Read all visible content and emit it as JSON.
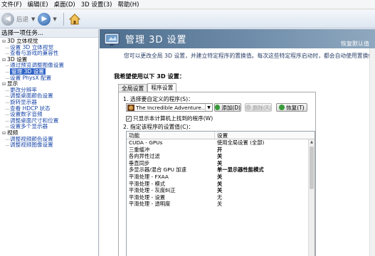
{
  "menu": [
    "文件(F)",
    "编辑(E)",
    "桌面(D)",
    "3D 设置(3)",
    "帮助(H)"
  ],
  "toolbar": {
    "back_label": "后退"
  },
  "left_panel": {
    "header": "选择一项任务...",
    "tree": [
      {
        "type": "cat",
        "label": "3D 立体视觉"
      },
      {
        "type": "child",
        "label": "设置 3D 立体视觉"
      },
      {
        "type": "child",
        "label": "查看与游戏的兼容性"
      },
      {
        "type": "cat",
        "label": "3D 设置"
      },
      {
        "type": "child",
        "label": "通过预览调整图像设置"
      },
      {
        "type": "child",
        "label": "管理 3D 设置",
        "selected": true
      },
      {
        "type": "child",
        "label": "设置 PhysX 配置"
      },
      {
        "type": "cat",
        "label": "显示"
      },
      {
        "type": "child",
        "label": "更改分辨率"
      },
      {
        "type": "child",
        "label": "调整桌面颜色设置"
      },
      {
        "type": "child",
        "label": "旋转显示器"
      },
      {
        "type": "child",
        "label": "查看 HDCP 状态"
      },
      {
        "type": "child",
        "label": "设置数字音频"
      },
      {
        "type": "child",
        "label": "调整桌面尺寸和位置"
      },
      {
        "type": "child",
        "label": "设置多个显示器"
      },
      {
        "type": "cat",
        "label": "视频"
      },
      {
        "type": "child",
        "label": "调整视频颜色设置"
      },
      {
        "type": "child",
        "label": "调整视频图像设置"
      }
    ]
  },
  "banner": {
    "title": "管理 3D 设置",
    "restore": "恢复默认值"
  },
  "description": "您可以更改全局 3D 设置，并建立特定程序的置换值。每次这些特定程序启动时，都会自动使用置换值。",
  "question": "我希望使用以下 3D 设置：",
  "tabs": [
    "全局设置",
    "程序设置"
  ],
  "program_settings": {
    "step1": "1. 选择要自定义的程序(S)：",
    "selected_program": "The Incredible Adventure...",
    "add_button": "添加(D)",
    "remove_button": "删除(R)",
    "restore_button": "恢复(T)",
    "checkbox_label": "只显示本计算机上找到的程序(W)",
    "checkbox_checked": true,
    "step2": "2. 指定该程序的设置值(C)：",
    "columns": [
      "功能",
      "设置"
    ],
    "rows": [
      {
        "feature": "CUDA - GPUs",
        "value": "使用全局设置 (全部)"
      },
      {
        "feature": "三重缓冲",
        "value": "开",
        "bold": true
      },
      {
        "feature": "各向异性过滤",
        "value": "关",
        "bold": true
      },
      {
        "feature": "垂直同步",
        "value": "关",
        "bold": true
      },
      {
        "feature": "多显示器/混合 GPU 加速",
        "value": "单一显示器性能模式",
        "bold": true
      },
      {
        "feature": "平滑处理 - FXAA",
        "value": "关",
        "bold": true
      },
      {
        "feature": "平滑处理 - 模式",
        "value": "关",
        "bold": true
      },
      {
        "feature": "平滑处理 - 灰度纠正",
        "value": "关",
        "bold": true
      },
      {
        "feature": "平滑处理 - 设置",
        "value": "无"
      },
      {
        "feature": "平滑处理 - 透明度",
        "value": "关"
      }
    ]
  },
  "colors": {
    "banner": "#5b7a99",
    "link": "#1a47a8",
    "selection": "#3164c8"
  }
}
